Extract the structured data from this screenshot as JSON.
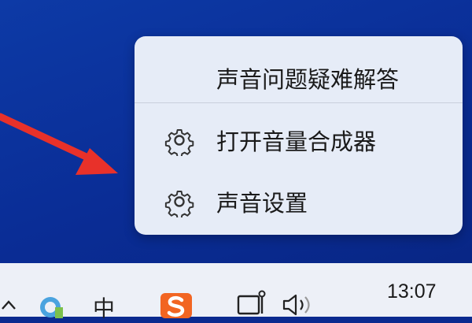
{
  "context_menu": {
    "items": [
      {
        "label": "声音问题疑难解答",
        "icon": null
      },
      {
        "label": "打开音量合成器",
        "icon": "gear-icon"
      },
      {
        "label": "声音设置",
        "icon": "gear-icon"
      }
    ]
  },
  "taskbar": {
    "ime_label": "中",
    "clock_time": "13:07"
  },
  "colors": {
    "desktop": "#0b2a8f",
    "menu_background": "#e6ecf7",
    "taskbar": "#edf0f7",
    "annotation_arrow": "#e8312a",
    "sogou_orange": "#f26522"
  }
}
